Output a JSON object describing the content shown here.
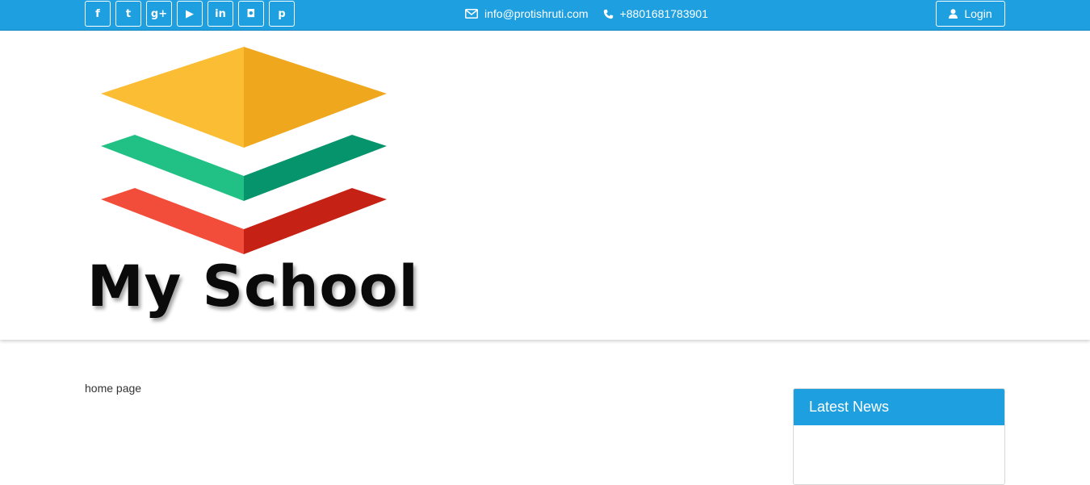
{
  "topbar": {
    "social": [
      {
        "name": "facebook",
        "glyph": "f"
      },
      {
        "name": "twitter",
        "glyph": "t"
      },
      {
        "name": "google-plus",
        "glyph": "g+"
      },
      {
        "name": "youtube",
        "glyph": "▶"
      },
      {
        "name": "linkedin",
        "glyph": "in"
      },
      {
        "name": "instagram",
        "glyph": "◘"
      },
      {
        "name": "pinterest",
        "glyph": "p"
      }
    ],
    "email": "info@protishruti.com",
    "phone": "+8801681783901",
    "login_label": "Login"
  },
  "logo": {
    "text": "My School"
  },
  "main": {
    "breadcrumb": "home page"
  },
  "sidebar": {
    "news_title": "Latest News"
  },
  "colors": {
    "accent": "#1e9fdf",
    "logo_yellow": "#fbbd33",
    "logo_green": "#21c185",
    "logo_red": "#f24d3b"
  }
}
